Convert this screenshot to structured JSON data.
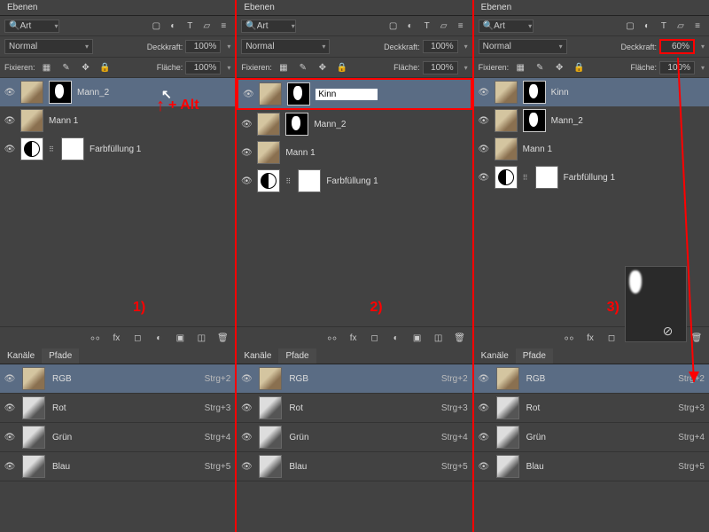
{
  "panel_title": "Ebenen",
  "search_label": "Art",
  "blend_mode": "Normal",
  "opacity_label": "Deckkraft:",
  "fill_label": "Fläche:",
  "lock_label": "Fixieren:",
  "value_100": "100%",
  "value_60": "60%",
  "channels_tab": "Kanäle",
  "paths_tab": "Pfade",
  "annotations": {
    "step1": "1)",
    "step2": "2)",
    "step3": "3)",
    "alt_hint": "+ Alt"
  },
  "panel1_layers": [
    {
      "name": "Mann_2",
      "selected": true,
      "type": "masked"
    },
    {
      "name": "Mann 1",
      "selected": false,
      "type": "plain"
    },
    {
      "name": "Farbfüllung 1",
      "selected": false,
      "type": "fill"
    }
  ],
  "panel2_layers": [
    {
      "name": "Kinn",
      "selected": true,
      "type": "masked",
      "editing": true,
      "boxed": true,
      "editValue": "Kinn"
    },
    {
      "name": "Mann_2",
      "selected": false,
      "type": "masked"
    },
    {
      "name": "Mann 1",
      "selected": false,
      "type": "plain"
    },
    {
      "name": "Farbfüllung 1",
      "selected": false,
      "type": "fill"
    }
  ],
  "panel3_layers": [
    {
      "name": "Kinn",
      "selected": true,
      "type": "masked"
    },
    {
      "name": "Mann_2",
      "selected": false,
      "type": "masked"
    },
    {
      "name": "Mann 1",
      "selected": false,
      "type": "plain"
    },
    {
      "name": "Farbfüllung 1",
      "selected": false,
      "type": "fill"
    }
  ],
  "channels": [
    {
      "name": "RGB",
      "shortcut": "Strg+2",
      "selected": true
    },
    {
      "name": "Rot",
      "shortcut": "Strg+3",
      "selected": false
    },
    {
      "name": "Grün",
      "shortcut": "Strg+4",
      "selected": false
    },
    {
      "name": "Blau",
      "shortcut": "Strg+5",
      "selected": false
    }
  ],
  "top_icons": [
    "image",
    "adjust",
    "text",
    "polygon",
    "filter"
  ]
}
